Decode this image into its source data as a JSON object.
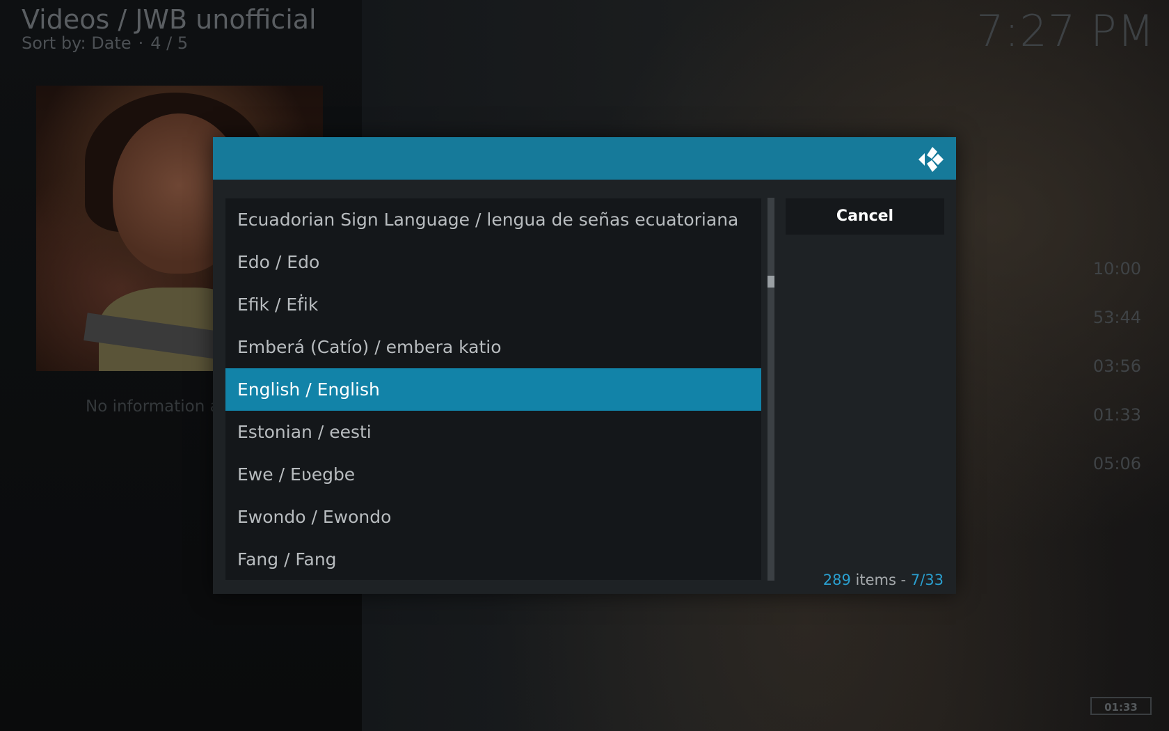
{
  "header": {
    "title": "Videos / JWB unofficial",
    "sort_label": "Sort by: Date",
    "sort_separator": "·",
    "position": "4 / 5"
  },
  "clock": "7:27 PM",
  "background": {
    "info_text": "No information a",
    "durations": [
      "10:00",
      "53:44",
      "03:56",
      "01:33",
      "05:06"
    ],
    "mini_time": "01:33"
  },
  "dialog": {
    "items": [
      {
        "label": "Ecuadorian Sign Language / lengua de señas ecuatoriana"
      },
      {
        "label": "Edo / Edo"
      },
      {
        "label": "Efik / Eḟik"
      },
      {
        "label": "Emberá (Catío) / embera katio"
      },
      {
        "label": "English / English",
        "selected": true
      },
      {
        "label": "Estonian / eesti"
      },
      {
        "label": "Ewe / Eʋegbe"
      },
      {
        "label": "Ewondo / Ewondo"
      },
      {
        "label": "Fang / Fang"
      }
    ],
    "cancel_label": "Cancel",
    "count": {
      "total": "289",
      "items_label": "items -",
      "page": "7/33"
    },
    "scroll_position": 0.21
  },
  "colors": {
    "accent": "#167a9a",
    "selected": "#1283a8",
    "count_accent": "#2a9fcf"
  },
  "icons": {
    "logo": "kodi-logo-icon"
  }
}
